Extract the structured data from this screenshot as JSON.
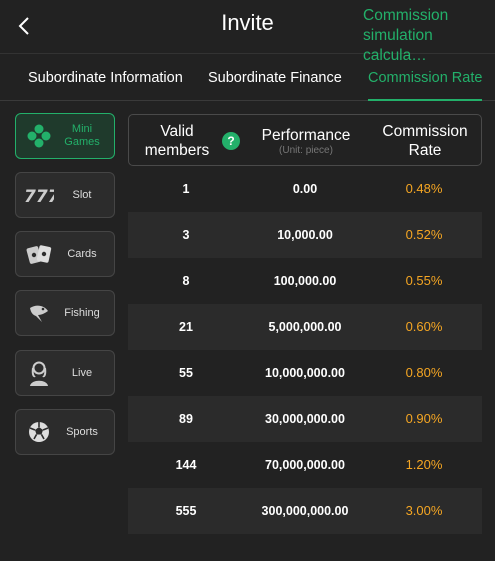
{
  "header": {
    "title": "Invite",
    "simulation_link": "Commission simulation calcula…"
  },
  "tabs": [
    {
      "label": "Subordinate Information",
      "active": false
    },
    {
      "label": "Subordinate Finance",
      "active": false
    },
    {
      "label": "Commission Rate",
      "active": true
    }
  ],
  "categories": [
    {
      "label": "Mini Games",
      "icon": "mini-games-icon",
      "active": true
    },
    {
      "label": "Slot",
      "icon": "slot-777-icon",
      "active": false
    },
    {
      "label": "Cards",
      "icon": "playing-cards-icon",
      "active": false
    },
    {
      "label": "Fishing",
      "icon": "fish-icon",
      "active": false
    },
    {
      "label": "Live",
      "icon": "live-dealer-icon",
      "active": false
    },
    {
      "label": "Sports",
      "icon": "soccer-ball-icon",
      "active": false
    }
  ],
  "table": {
    "headers": {
      "valid_members": "Valid members",
      "performance": "Performance",
      "performance_unit": "(Unit: piece)",
      "commission_rate": "Commission Rate"
    },
    "help_icon": "?",
    "rows": [
      {
        "members": "1",
        "performance": "0.00",
        "rate": "0.48%"
      },
      {
        "members": "3",
        "performance": "10,000.00",
        "rate": "0.52%"
      },
      {
        "members": "8",
        "performance": "100,000.00",
        "rate": "0.55%"
      },
      {
        "members": "21",
        "performance": "5,000,000.00",
        "rate": "0.60%"
      },
      {
        "members": "55",
        "performance": "10,000,000.00",
        "rate": "0.80%"
      },
      {
        "members": "89",
        "performance": "30,000,000.00",
        "rate": "0.90%"
      },
      {
        "members": "144",
        "performance": "70,000,000.00",
        "rate": "1.20%"
      },
      {
        "members": "555",
        "performance": "300,000,000.00",
        "rate": "3.00%"
      }
    ]
  },
  "colors": {
    "accent": "#23b06a",
    "rate": "#f5a623",
    "background": "#222222",
    "row_alt": "#2b2b2b"
  }
}
